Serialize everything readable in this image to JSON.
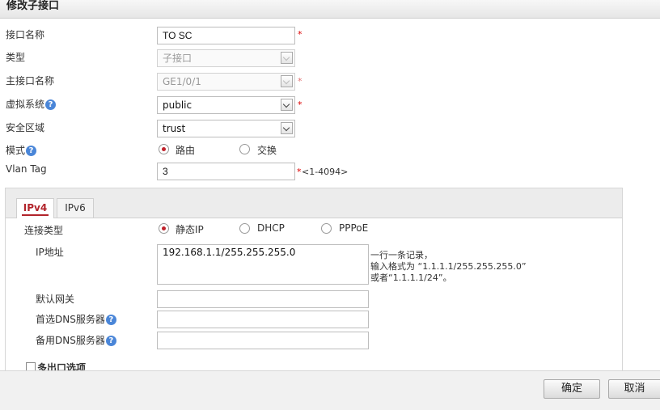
{
  "dialog": {
    "title": "修改子接口"
  },
  "form": {
    "interface_name": {
      "label": "接口名称",
      "value": "TO SC"
    },
    "type": {
      "label": "类型",
      "value": "子接口"
    },
    "parent_interface": {
      "label": "主接口名称",
      "value": "GE1/0/1"
    },
    "virtual_system": {
      "label": "虚拟系统",
      "value": "public"
    },
    "security_zone": {
      "label": "安全区域",
      "value": "trust"
    },
    "mode": {
      "label": "模式",
      "options": [
        "路由",
        "交换"
      ],
      "selected": "路由"
    },
    "vlan_tag": {
      "label": "Vlan Tag",
      "value": "3",
      "range": "<1-4094>"
    },
    "required_mark": "*"
  },
  "tabs": [
    {
      "label": "IPv4",
      "active": true
    },
    {
      "label": "IPv6",
      "active": false
    }
  ],
  "ipv4": {
    "connection_type": {
      "label": "连接类型",
      "options": [
        "静态IP",
        "DHCP",
        "PPPoE"
      ],
      "selected": "静态IP"
    },
    "ip_address": {
      "label": "IP地址",
      "value": "192.168.1.1/255.255.255.0",
      "hint": [
        "一行一条记录，",
        "输入格式为 “1.1.1.1/255.255.255.0”",
        "或者“1.1.1.1/24”。"
      ]
    },
    "default_gateway": {
      "label": "默认网关",
      "value": ""
    },
    "preferred_dns": {
      "label": "首选DNS服务器",
      "value": ""
    },
    "alternate_dns": {
      "label": "备用DNS服务器",
      "value": ""
    },
    "multi_egress": {
      "label": "多出口选项"
    }
  },
  "footer": {
    "ok_label": "确定",
    "cancel_label": "取消"
  },
  "icons": {
    "help": "help-icon",
    "dropdown": "chevron-down-icon"
  },
  "colors": {
    "accent": "#b2242b",
    "required": "#dd0000",
    "help": "#4a86d8"
  }
}
